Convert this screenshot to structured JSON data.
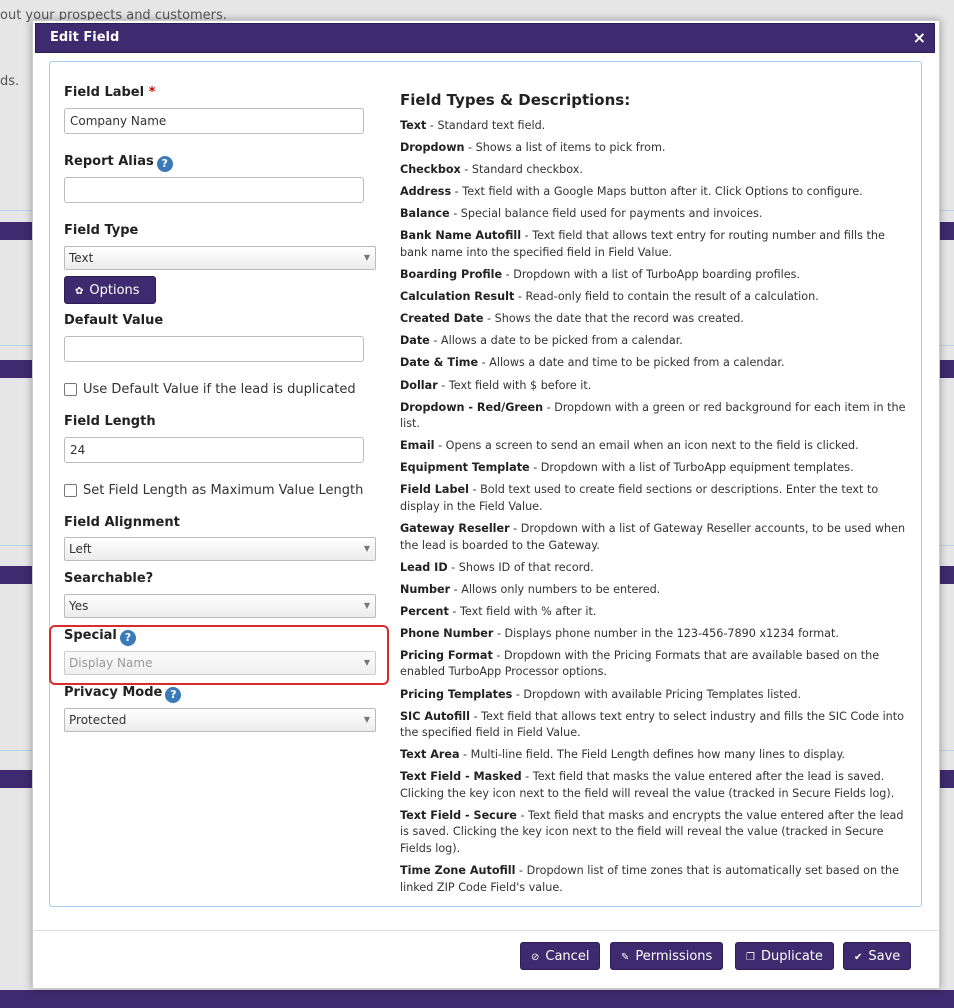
{
  "background": {
    "text_top": "out your prospects and customers.",
    "text_side": "ds."
  },
  "dialog": {
    "title": "Edit Field",
    "close_glyph": "×"
  },
  "form": {
    "field_label": {
      "label": "Field Label",
      "required_mark": "*",
      "value": "Company Name"
    },
    "report_alias": {
      "label": "Report Alias",
      "help": "?",
      "value": ""
    },
    "field_type": {
      "label": "Field Type",
      "value": "Text"
    },
    "options_button": "Options",
    "default_value": {
      "label": "Default Value",
      "value": ""
    },
    "use_default_checkbox": "Use Default Value if the lead is duplicated",
    "field_length": {
      "label": "Field Length",
      "value": "24"
    },
    "set_length_checkbox": "Set Field Length as Maximum Value Length",
    "field_alignment": {
      "label": "Field Alignment",
      "value": "Left"
    },
    "searchable": {
      "label": "Searchable?",
      "value": "Yes"
    },
    "special": {
      "label": "Special",
      "help": "?",
      "value": "Display Name"
    },
    "privacy_mode": {
      "label": "Privacy Mode",
      "help": "?",
      "value": "Protected"
    }
  },
  "field_types": {
    "heading": "Field Types & Descriptions:",
    "items": [
      {
        "name": "Text",
        "desc": " - Standard text field."
      },
      {
        "name": "Dropdown",
        "desc": " - Shows a list of items to pick from."
      },
      {
        "name": "Checkbox",
        "desc": " - Standard checkbox."
      },
      {
        "name": "Address",
        "desc": " - Text field with a Google Maps button after it. Click Options to configure."
      },
      {
        "name": "Balance",
        "desc": " - Special balance field used for payments and invoices."
      },
      {
        "name": "Bank Name Autofill",
        "desc": " - Text field that allows text entry for routing number and fills the bank name into the specified field in Field Value."
      },
      {
        "name": "Boarding Profile",
        "desc": " - Dropdown with a list of TurboApp boarding profiles."
      },
      {
        "name": "Calculation Result",
        "desc": " - Read-only field to contain the result of a calculation."
      },
      {
        "name": "Created Date",
        "desc": " - Shows the date that the record was created."
      },
      {
        "name": "Date",
        "desc": " - Allows a date to be picked from a calendar."
      },
      {
        "name": "Date & Time",
        "desc": " - Allows a date and time to be picked from a calendar."
      },
      {
        "name": "Dollar",
        "desc": " - Text field with $ before it."
      },
      {
        "name": "Dropdown - Red/Green",
        "desc": " - Dropdown with a green or red background for each item in the list."
      },
      {
        "name": "Email",
        "desc": " - Opens a screen to send an email when an icon next to the field is clicked."
      },
      {
        "name": "Equipment Template",
        "desc": " - Dropdown with a list of TurboApp equipment templates."
      },
      {
        "name": "Field Label",
        "desc": " - Bold text used to create field sections or descriptions. Enter the text to display in the Field Value."
      },
      {
        "name": "Gateway Reseller",
        "desc": " - Dropdown with a list of Gateway Reseller accounts, to be used when the lead is boarded to the Gateway."
      },
      {
        "name": "Lead ID",
        "desc": " - Shows ID of that record."
      },
      {
        "name": "Number",
        "desc": " - Allows only numbers to be entered."
      },
      {
        "name": "Percent",
        "desc": " - Text field with % after it."
      },
      {
        "name": "Phone Number",
        "desc": " - Displays phone number in the 123-456-7890 x1234 format."
      },
      {
        "name": "Pricing Format",
        "desc": " - Dropdown with the Pricing Formats that are available based on the enabled TurboApp Processor options."
      },
      {
        "name": "Pricing Templates",
        "desc": " - Dropdown with available Pricing Templates listed."
      },
      {
        "name": "SIC Autofill",
        "desc": " - Text field that allows text entry to select industry and fills the SIC Code into the specified field in Field Value."
      },
      {
        "name": "Text Area",
        "desc": " - Multi-line field. The Field Length defines how many lines to display."
      },
      {
        "name": "Text Field - Masked",
        "desc": " - Text field that masks the value entered after the lead is saved. Clicking the key icon next to the field will reveal the value (tracked in Secure Fields log)."
      },
      {
        "name": "Text Field - Secure",
        "desc": " - Text field that masks and encrypts the value entered after the lead is saved. Clicking the key icon next to the field will reveal the value (tracked in Secure Fields log)."
      },
      {
        "name": "Time Zone Autofill",
        "desc": " - Dropdown list of time zones that is automatically set based on the linked ZIP Code Field's value."
      }
    ]
  },
  "footer": {
    "cancel": "Cancel",
    "permissions": "Permissions",
    "duplicate": "Duplicate",
    "save": "Save"
  },
  "icons": {
    "options": "gear-icon",
    "cancel": "ban-icon",
    "permissions": "key-icon",
    "duplicate": "copy-icon",
    "save": "check-icon"
  },
  "colors": {
    "brand": "#3e2a6e",
    "highlight": "#d92b2b",
    "help": "#3a7ab8"
  }
}
